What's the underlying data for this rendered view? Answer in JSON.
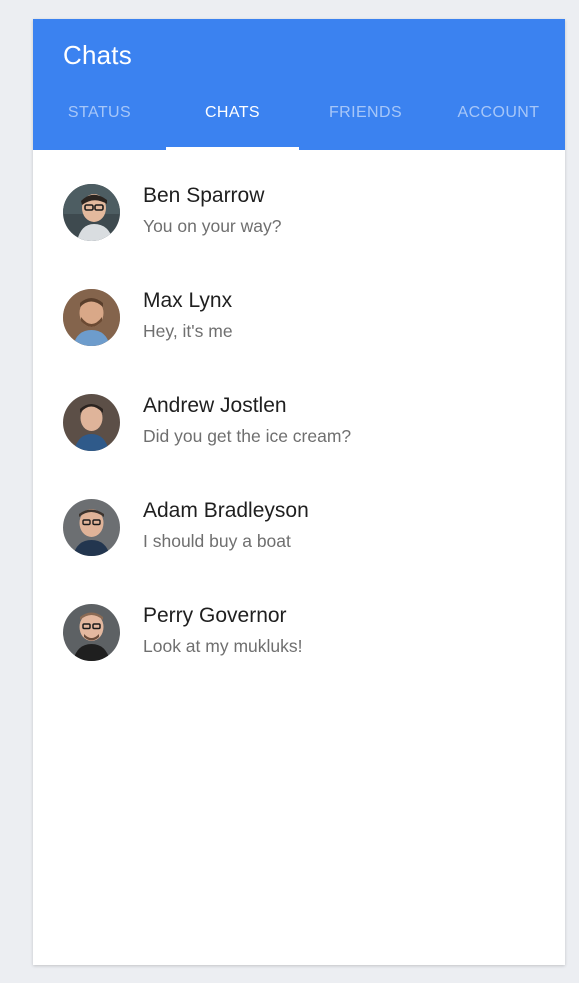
{
  "app_bar": {
    "title": "Chats",
    "color": "#3b82f0"
  },
  "tabs": [
    {
      "label": "STATUS",
      "active": false
    },
    {
      "label": "CHATS",
      "active": true
    },
    {
      "label": "FRIENDS",
      "active": false
    },
    {
      "label": "ACCOUNT",
      "active": false
    }
  ],
  "chats": [
    {
      "name": "Ben Sparrow",
      "preview": "You on your way?",
      "avatar_icon": "avatar-ben-sparrow"
    },
    {
      "name": "Max Lynx",
      "preview": "Hey, it's me",
      "avatar_icon": "avatar-max-lynx"
    },
    {
      "name": "Andrew Jostlen",
      "preview": "Did you get the ice cream?",
      "avatar_icon": "avatar-andrew-jostlen"
    },
    {
      "name": "Adam Bradleyson",
      "preview": "I should buy a boat",
      "avatar_icon": "avatar-adam-bradleyson"
    },
    {
      "name": "Perry Governor",
      "preview": "Look at my mukluks!",
      "avatar_icon": "avatar-perry-governor"
    }
  ]
}
